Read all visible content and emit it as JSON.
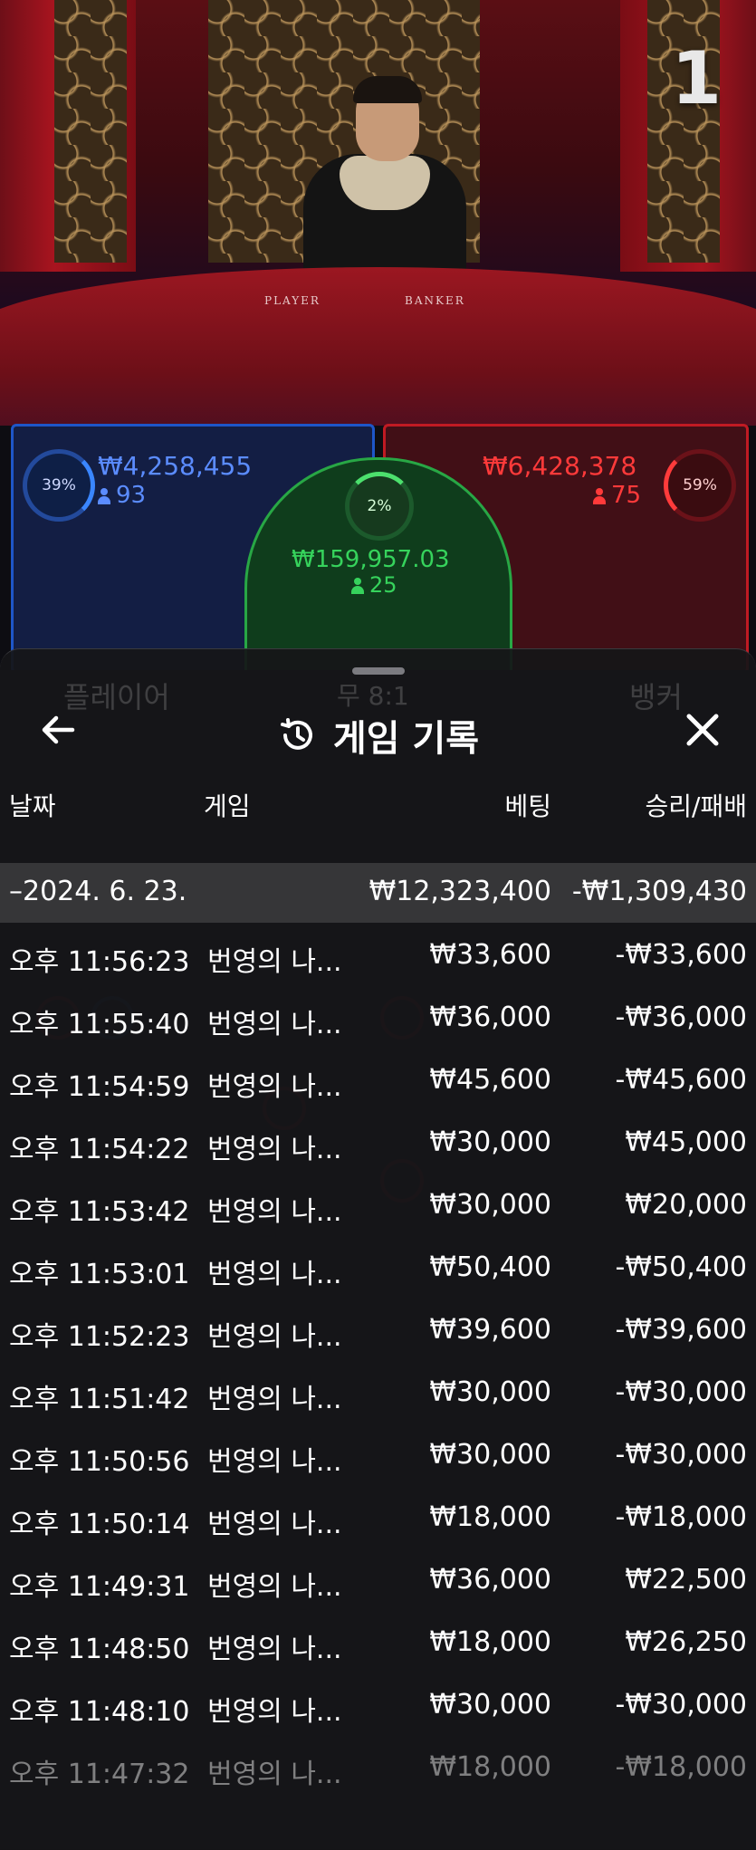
{
  "video": {
    "round_number": "1",
    "felt_labels": {
      "player": "PLAYER",
      "banker": "BANKER"
    },
    "player": {
      "percent": "39%",
      "amount": "₩4,258,455",
      "count": "93"
    },
    "banker": {
      "percent": "59%",
      "amount": "₩6,428,378",
      "count": "75"
    },
    "tie": {
      "percent": "2%",
      "amount": "₩159,957.03",
      "count": "25"
    }
  },
  "background_ui": {
    "player_label": "플레이어",
    "tie_label": "무 8:1",
    "banker_label": "뱅커"
  },
  "sheet": {
    "title": "게임 기록",
    "columns": {
      "date": "날짜",
      "game": "게임",
      "bet": "베팅",
      "win_loss": "승리/패배"
    },
    "summary": {
      "date": "–2024. 6. 23.",
      "bet": "₩12,323,400",
      "win_loss": "-₩1,309,430"
    },
    "rows": [
      {
        "time": "오후 11:56:23",
        "game": "번영의 나...",
        "bet": "₩33,600",
        "win_loss": "-₩33,600"
      },
      {
        "time": "오후 11:55:40",
        "game": "번영의 나...",
        "bet": "₩36,000",
        "win_loss": "-₩36,000"
      },
      {
        "time": "오후 11:54:59",
        "game": "번영의 나...",
        "bet": "₩45,600",
        "win_loss": "-₩45,600"
      },
      {
        "time": "오후 11:54:22",
        "game": "번영의 나...",
        "bet": "₩30,000",
        "win_loss": "₩45,000"
      },
      {
        "time": "오후 11:53:42",
        "game": "번영의 나...",
        "bet": "₩30,000",
        "win_loss": "₩20,000"
      },
      {
        "time": "오후 11:53:01",
        "game": "번영의 나...",
        "bet": "₩50,400",
        "win_loss": "-₩50,400"
      },
      {
        "time": "오후 11:52:23",
        "game": "번영의 나...",
        "bet": "₩39,600",
        "win_loss": "-₩39,600"
      },
      {
        "time": "오후 11:51:42",
        "game": "번영의 나...",
        "bet": "₩30,000",
        "win_loss": "-₩30,000"
      },
      {
        "time": "오후 11:50:56",
        "game": "번영의 나...",
        "bet": "₩30,000",
        "win_loss": "-₩30,000"
      },
      {
        "time": "오후 11:50:14",
        "game": "번영의 나...",
        "bet": "₩18,000",
        "win_loss": "-₩18,000"
      },
      {
        "time": "오후 11:49:31",
        "game": "번영의 나...",
        "bet": "₩36,000",
        "win_loss": "₩22,500"
      },
      {
        "time": "오후 11:48:50",
        "game": "번영의 나...",
        "bet": "₩18,000",
        "win_loss": "₩26,250"
      },
      {
        "time": "오후 11:48:10",
        "game": "번영의 나...",
        "bet": "₩30,000",
        "win_loss": "-₩30,000"
      },
      {
        "time": "오후 11:47:32",
        "game": "번영의 나...",
        "bet": "₩18,000",
        "win_loss": "-₩18,000"
      }
    ]
  },
  "icons": {
    "back": "arrow-left-icon",
    "history": "history-icon",
    "close": "close-icon"
  },
  "colors": {
    "player_blue": "#5b8cff",
    "banker_red": "#ff3a3a",
    "tie_green": "#36d35c"
  }
}
